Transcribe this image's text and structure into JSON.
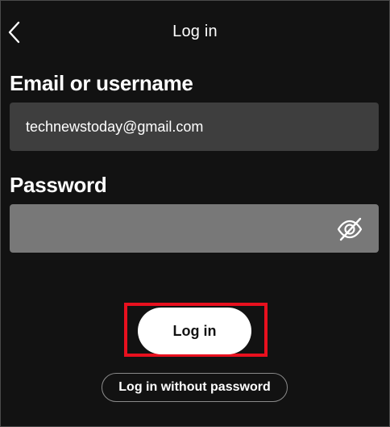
{
  "header": {
    "title": "Log in",
    "back_icon": "chevron-left-icon"
  },
  "form": {
    "email_label": "Email or username",
    "email_value": "technewstoday@gmail.com",
    "password_label": "Password",
    "password_value": "",
    "password_toggle_icon": "eye-slash-icon"
  },
  "actions": {
    "login_label": "Log in",
    "login_without_password_label": "Log in without password",
    "highlight_color": "#e8101e"
  },
  "colors": {
    "background": "#121212",
    "email_field_bg": "#3e3e3e",
    "password_field_bg": "#787878",
    "button_bg": "#ffffff"
  }
}
